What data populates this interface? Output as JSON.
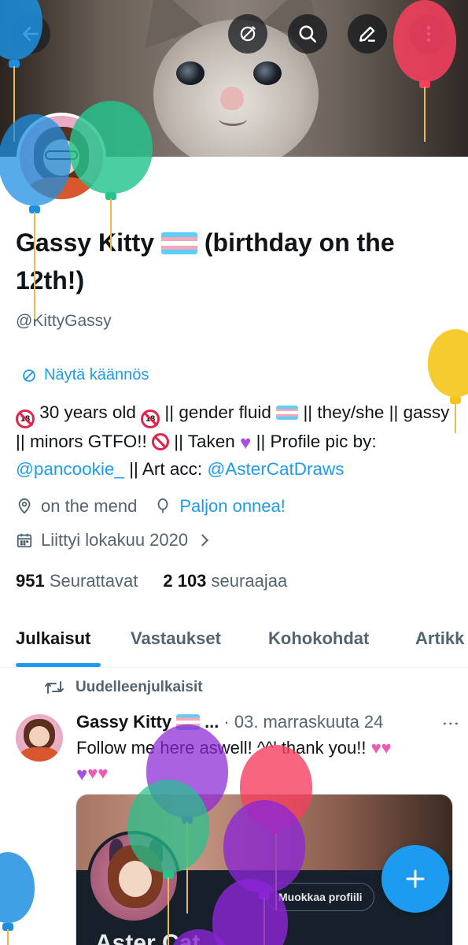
{
  "colors": {
    "accent": "#1d9bf0",
    "text_primary": "#0f1419",
    "text_secondary": "#536471"
  },
  "header": {
    "icons": [
      "back-arrow-icon",
      "translate-icon",
      "search-icon",
      "edit-icon",
      "more-icon"
    ]
  },
  "profile": {
    "display_name_part1": "Gassy Kitty",
    "display_name_part2": "(birthday on the 12th!)",
    "handle": "@KittyGassy",
    "translate_label": "Näytä käännös",
    "bio": {
      "age": "30 years old",
      "segment_2": "|| gender fluid",
      "segment_3": "|| they/she || gassy || minors GTFO!!",
      "segment_4": "|| Taken",
      "segment_5": "||  Profile pic by:",
      "mention_1": "@pancookie_",
      "segment_6": "|| Art acc:",
      "mention_2": "@AsterCatDraws"
    },
    "location": "on the mend",
    "birthday_label": "Paljon onnea!",
    "joined": "Liittyi lokakuu 2020",
    "following_count": "951",
    "following_label": "Seurattavat",
    "followers_count": "2 103",
    "followers_label": "seuraajaa"
  },
  "tabs": [
    {
      "label": "Julkaisut",
      "active": true
    },
    {
      "label": "Vastaukset",
      "active": false
    },
    {
      "label": "Kohokohdat",
      "active": false
    },
    {
      "label": "Artikk",
      "active": false
    }
  ],
  "post": {
    "repost_label": "Uudelleenjulkaisit",
    "author": "Gassy Kitty",
    "author_truncation": "...",
    "date": "· 03. marraskuuta 24",
    "text": "Follow me here aswell! ^^' thank you!!",
    "media": {
      "button_label": "Muokkaa profiili",
      "name": "Aster Cat"
    }
  },
  "fab": {
    "icon": "plus-icon"
  }
}
